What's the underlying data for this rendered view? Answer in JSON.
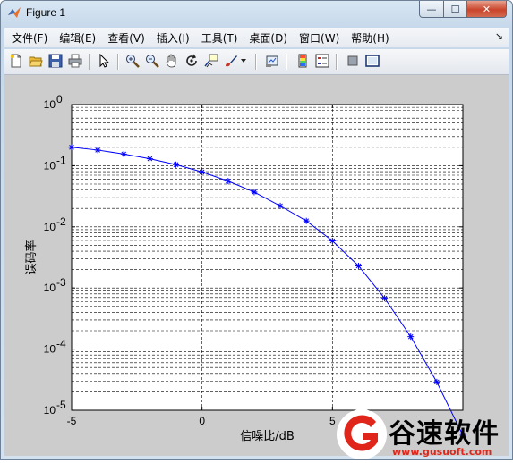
{
  "window": {
    "title": "Figure 1",
    "controls": {
      "minimize": "—",
      "maximize": "☐",
      "close": "✕"
    }
  },
  "menu": {
    "items": [
      "文件(F)",
      "编辑(E)",
      "查看(V)",
      "插入(I)",
      "工具(T)",
      "桌面(D)",
      "窗口(W)",
      "帮助(H)"
    ],
    "overflow_glyph": "↘"
  },
  "toolbar": {
    "icons": [
      "new-figure-icon",
      "open-file-icon",
      "save-icon",
      "print-icon",
      "select-arrow-icon",
      "zoom-in-icon",
      "zoom-out-icon",
      "pan-hand-icon",
      "rotate-3d-icon",
      "data-cursor-icon",
      "brush-icon",
      "brush-dropdown-icon",
      "link-plot-icon",
      "colorbar-icon",
      "legend-icon",
      "hide-plot-tools-icon",
      "show-plot-tools-icon"
    ]
  },
  "chart_data": {
    "type": "line",
    "title": "",
    "xlabel": "信噪比/dB",
    "ylabel": "误码率",
    "xlim": [
      -5,
      10
    ],
    "ylim": [
      1e-05,
      1
    ],
    "yscale": "log",
    "grid": true,
    "x_ticks": [
      -5,
      0,
      5
    ],
    "x_tick_labels": [
      "-5",
      "0",
      "5"
    ],
    "y_ticks": [
      1e-05,
      0.0001,
      0.001,
      0.01,
      0.1,
      1
    ],
    "y_tick_bases": [
      "10",
      "10",
      "10",
      "10",
      "10",
      "10"
    ],
    "y_tick_exponents": [
      "-5",
      "-4",
      "-3",
      "-2",
      "-1",
      "0"
    ],
    "series": [
      {
        "color": "#0000ff",
        "marker": "*",
        "x": [
          -5,
          -4,
          -3,
          -2,
          -1,
          0,
          1,
          2,
          3,
          4,
          5,
          6,
          7,
          8,
          9,
          10
        ],
        "y": [
          0.2,
          0.18,
          0.155,
          0.13,
          0.104,
          0.079,
          0.056,
          0.037,
          0.022,
          0.0125,
          0.0059,
          0.0023,
          0.00068,
          0.00016,
          2.9e-05,
          3.9e-06
        ]
      }
    ]
  },
  "watermark": {
    "brand": "谷速软件",
    "url": "www.gusuoft.com",
    "colors": {
      "red": "#e0261b",
      "black": "#000000"
    }
  }
}
